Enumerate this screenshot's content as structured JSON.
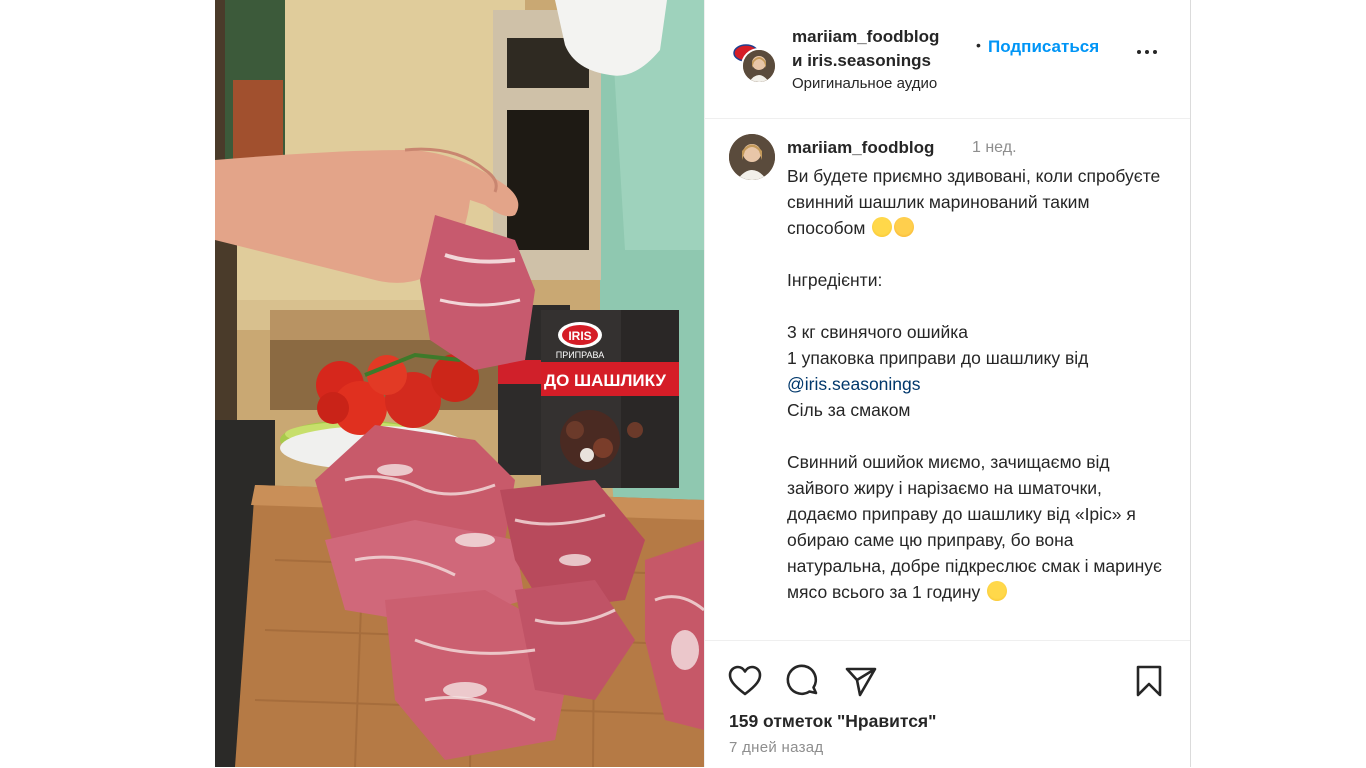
{
  "header": {
    "user_primary": "mariiam_foodblog",
    "connector": "и",
    "user_secondary": "iris.seasonings",
    "separator": "•",
    "follow_label": "Подписаться",
    "audio": "Оригинальное аудио"
  },
  "caption": {
    "username": "mariiam_foodblog",
    "time": "1 нед.",
    "intro": "Ви будете приємно здивовані, коли спробуєте свинний шашлик маринований таким способом",
    "ingredients_title": "Інгредієнти:",
    "ingredient_1": "3 кг свинячого ошийка",
    "ingredient_2": "1 упаковка приправи до шашлику від",
    "mention": "@iris.seasonings",
    "ingredient_3": "Сіль за смаком",
    "method": "Свинний ошийок миємо, зачищаємо від зайвого жиру і нарізаємо на шматочки, додаємо приправу до шашлику від «Іріс» я обираю саме цю приправу, бо вона натуральна, добре підкреслює смак і маринує мясо всього за 1 годину"
  },
  "media": {
    "package_brand": "IRIS",
    "package_subtitle": "ПРИПРАВА",
    "package_title": "ДО ШАШЛИКУ"
  },
  "actions": {
    "icons": [
      "heart-icon",
      "comment-icon",
      "share-icon",
      "bookmark-icon"
    ],
    "likes": "159 отметок \"Нравится\"",
    "date": "7 дней назад"
  },
  "colors": {
    "accent": "#0095f6",
    "text": "#262626",
    "muted": "#8e8e8e",
    "mention": "#00376b"
  }
}
